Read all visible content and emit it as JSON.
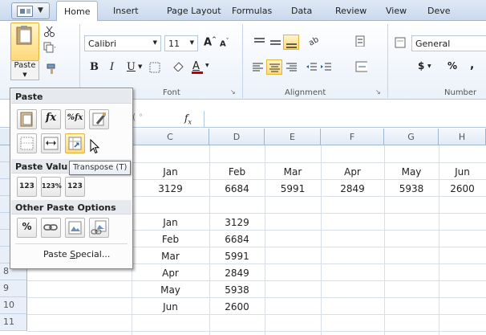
{
  "ribbon_tabs": [
    "Home",
    "Insert",
    "Page Layout",
    "Formulas",
    "Data",
    "Review",
    "View",
    "Deve"
  ],
  "clipboard": {
    "paste_label": "Paste"
  },
  "font": {
    "name": "Calibri",
    "size": "11",
    "grow": "A",
    "shrink": "A",
    "bold": "B",
    "italic": "I",
    "underline": "U",
    "font_color_letter": "A",
    "group_label": "Font"
  },
  "alignment": {
    "group_label": "Alignment"
  },
  "number": {
    "format": "General",
    "currency": "$",
    "percent": "%",
    "comma": ",",
    "group_label": "Number"
  },
  "formula_bar": {
    "fx": "f",
    "fx_sub": "x"
  },
  "columns": [
    "C",
    "D",
    "E",
    "F",
    "G",
    "H"
  ],
  "row_numbers": [
    "8",
    "9",
    "10",
    "11"
  ],
  "sheet": {
    "row2": [
      "Jan",
      "Feb",
      "Mar",
      "Apr",
      "May",
      "Jun"
    ],
    "row3": [
      "3129",
      "6684",
      "5991",
      "2849",
      "5938",
      "2600"
    ],
    "col_months": [
      "Jan",
      "Feb",
      "Mar",
      "Apr",
      "May",
      "Jun"
    ],
    "col_values": [
      "3129",
      "6684",
      "5991",
      "2849",
      "5938",
      "2600"
    ]
  },
  "paste_menu": {
    "header": "Paste",
    "values_header": "Paste Valu",
    "other_header": "Other Paste Options",
    "special_prefix": "Paste ",
    "special_mnemonic": "S",
    "special_rest": "pecial...",
    "tooltip": "Transpose (T)",
    "glyphs": {
      "formula": "fx",
      "percent_formula": "%fx",
      "values_123": "123",
      "values_123_pct": "123%",
      "pct": "%"
    }
  },
  "colors": {
    "ribbon_bg": "#eaf1fa",
    "header_bg": "#e4ecf7",
    "highlight": "#ffd979",
    "font_color_bar": "#c00000"
  }
}
